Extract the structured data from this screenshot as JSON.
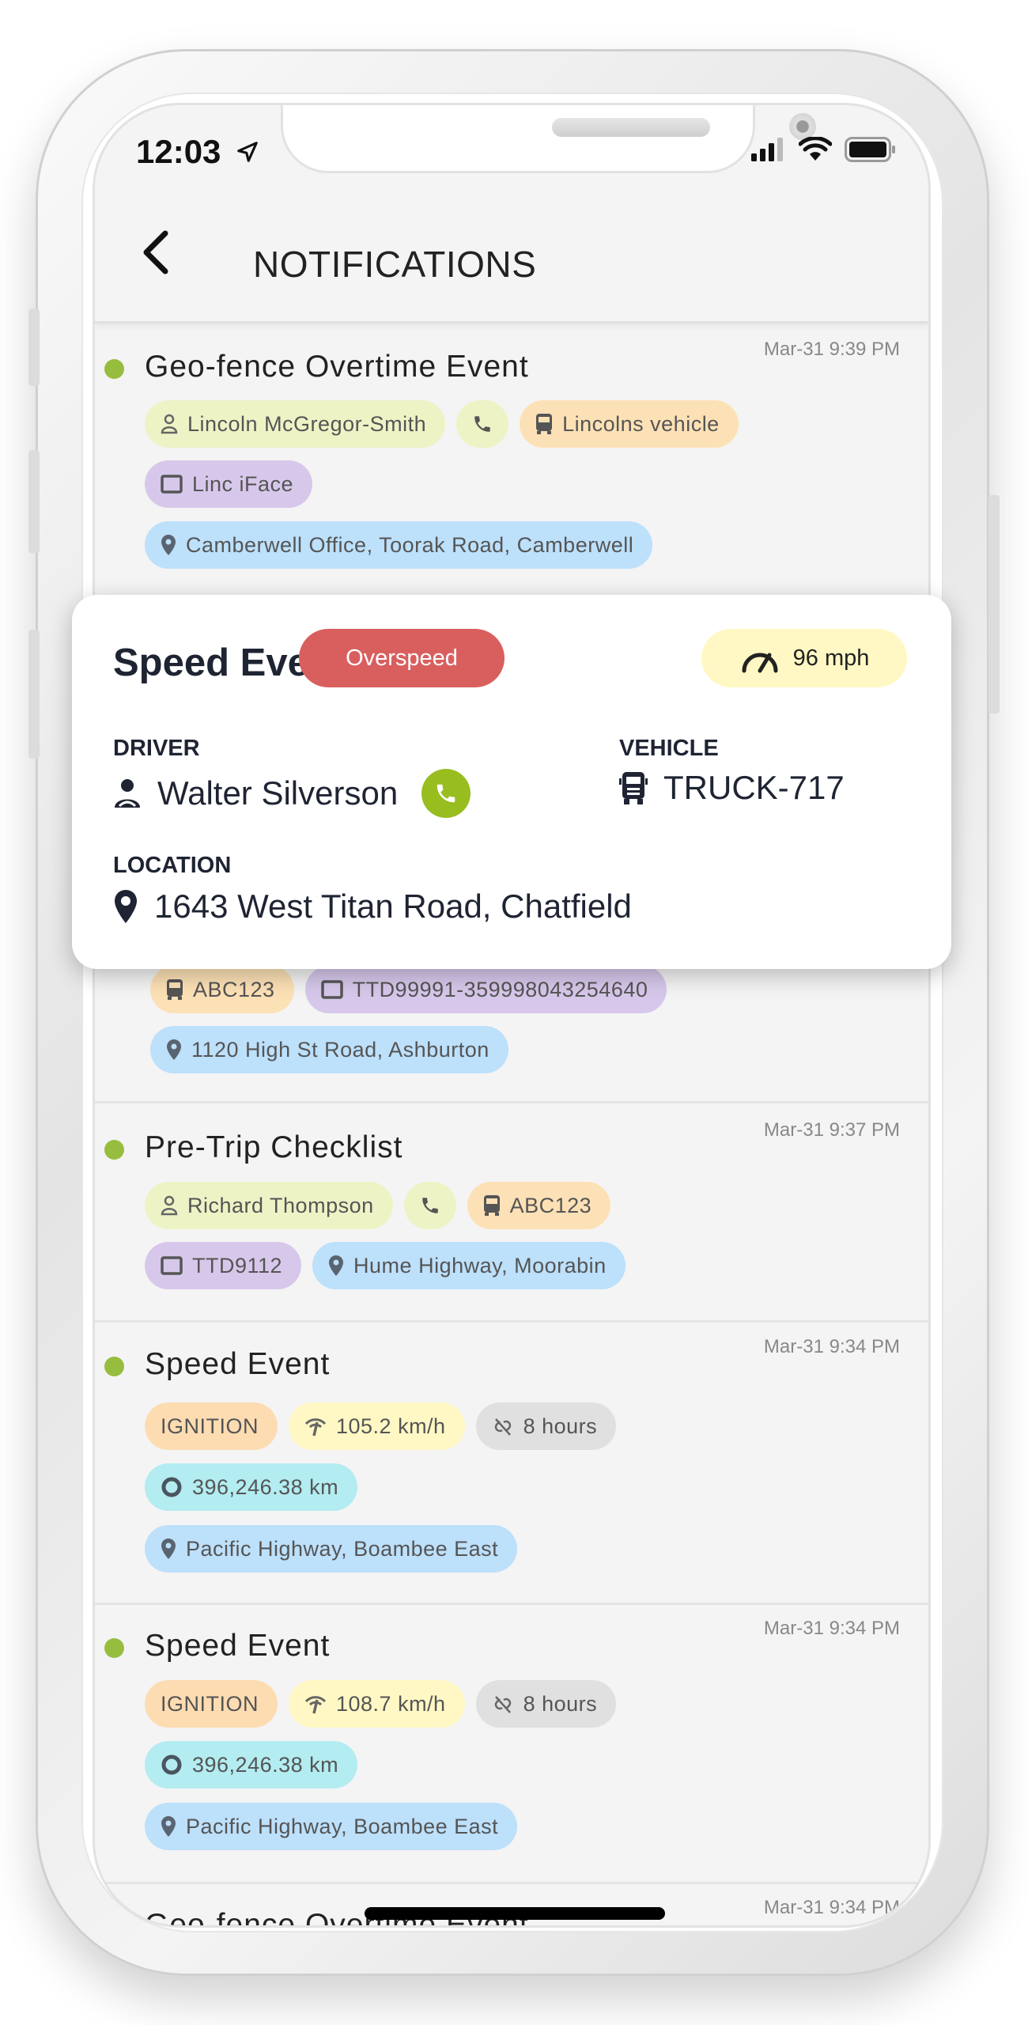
{
  "status_bar": {
    "time": "12:03"
  },
  "header": {
    "title": "NOTIFICATIONS"
  },
  "colors": {
    "dot": "#97bd3f",
    "driver_chip": "#eef3c6",
    "vehicle_chip": "#fde1b6",
    "device_chip": "#d7c8eb",
    "location_chip": "#bde0fb",
    "ignition_chip": "#fddcb2",
    "speed_chip": "#fff8c4",
    "hours_chip": "#e0e0e0",
    "odometer_chip": "#b3ecf1",
    "overspeed": "#d95f5f",
    "call_button": "#97bd1f"
  },
  "notifications": [
    {
      "title": "Geo-fence Overtime Event",
      "time": "Mar-31 9:39 PM",
      "rows": [
        [
          {
            "type": "driver",
            "icon": "person-outline-icon",
            "text": "Lincoln McGregor-Smith"
          },
          {
            "type": "call",
            "icon": "phone-icon",
            "text": ""
          },
          {
            "type": "vehicle",
            "icon": "bus-icon",
            "text": "Lincolns vehicle"
          }
        ],
        [
          {
            "type": "device",
            "icon": "device-icon",
            "text": "Linc iFace"
          }
        ],
        [
          {
            "type": "location",
            "icon": "map-pin-icon",
            "text": "Camberwell Office, Toorak Road, Camberwell"
          }
        ]
      ]
    },
    {
      "title": "",
      "time": "",
      "rows": [
        [
          {
            "type": "vehicle",
            "icon": "bus-icon",
            "text": "ABC123"
          },
          {
            "type": "device",
            "icon": "device-icon",
            "text": "TTD99991-359998043254640"
          }
        ],
        [
          {
            "type": "location",
            "icon": "map-pin-icon",
            "text": "1120 High St Road, Ashburton"
          }
        ]
      ]
    },
    {
      "title": "Pre-Trip Checklist",
      "time": "Mar-31 9:37 PM",
      "rows": [
        [
          {
            "type": "driver",
            "icon": "person-outline-icon",
            "text": "Richard Thompson"
          },
          {
            "type": "call",
            "icon": "phone-icon",
            "text": ""
          },
          {
            "type": "vehicle",
            "icon": "bus-icon",
            "text": "ABC123"
          }
        ],
        [
          {
            "type": "device",
            "icon": "device-icon",
            "text": "TTD9112"
          },
          {
            "type": "location",
            "icon": "map-pin-icon",
            "text": "Hume Highway, Moorabin"
          }
        ]
      ]
    },
    {
      "title": "Speed Event",
      "time": "Mar-31 9:34 PM",
      "rows": [
        [
          {
            "type": "ignition",
            "icon": "",
            "text": "IGNITION"
          },
          {
            "type": "speed",
            "icon": "speed-signal-icon",
            "text": "105.2 km/h"
          },
          {
            "type": "hours",
            "icon": "link-off-icon",
            "text": "8 hours"
          }
        ],
        [
          {
            "type": "odometer",
            "icon": "circle-icon",
            "text": "396,246.38 km"
          }
        ],
        [
          {
            "type": "location",
            "icon": "map-pin-icon",
            "text": "Pacific Highway, Boambee East"
          }
        ]
      ]
    },
    {
      "title": "Speed Event",
      "time": "Mar-31 9:34 PM",
      "rows": [
        [
          {
            "type": "ignition",
            "icon": "",
            "text": "IGNITION"
          },
          {
            "type": "speed",
            "icon": "speed-signal-icon",
            "text": "108.7 km/h"
          },
          {
            "type": "hours",
            "icon": "link-off-icon",
            "text": "8 hours"
          }
        ],
        [
          {
            "type": "odometer",
            "icon": "circle-icon",
            "text": "396,246.38 km"
          }
        ],
        [
          {
            "type": "location",
            "icon": "map-pin-icon",
            "text": "Pacific Highway, Boambee East"
          }
        ]
      ]
    },
    {
      "title": "Geo-fence Overtime Event",
      "time": "Mar-31 9:34 PM",
      "rows": []
    }
  ],
  "popup": {
    "title": "Speed Event",
    "badge": "Overspeed",
    "speed": "96 mph",
    "driver_label": "DRIVER",
    "driver": "Walter Silverson",
    "vehicle_label": "VEHICLE",
    "vehicle": "TRUCK-717",
    "location_label": "LOCATION",
    "location": "1643 West Titan Road, Chatfield"
  }
}
